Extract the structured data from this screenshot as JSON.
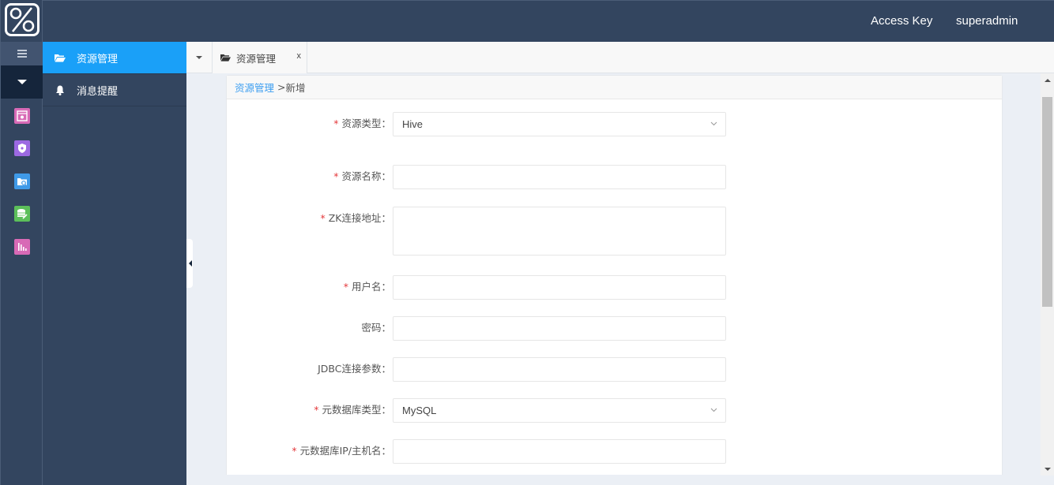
{
  "header": {
    "access_key_label": "Access Key",
    "username": "superadmin"
  },
  "rail": {
    "icons": [
      {
        "name": "dashboard-icon",
        "color": "#d86ab6"
      },
      {
        "name": "shield-icon",
        "color": "#9c69e2"
      },
      {
        "name": "folder-search-icon",
        "color": "#3f9ae8"
      },
      {
        "name": "database-edit-icon",
        "color": "#5cbf5a"
      },
      {
        "name": "bar-chart-icon",
        "color": "#d86ab6"
      }
    ]
  },
  "nav": {
    "items": [
      {
        "label": "资源管理",
        "icon": "folder-open-icon",
        "active": true
      },
      {
        "label": "消息提醒",
        "icon": "bell-icon",
        "active": false
      }
    ]
  },
  "tabs": [
    {
      "label": "资源管理",
      "close": "x"
    }
  ],
  "breadcrumb": {
    "parent": "资源管理",
    "separator": ">",
    "current": "新增"
  },
  "form": {
    "fields": [
      {
        "label": "资源类型：",
        "required": true,
        "type": "select",
        "value": "Hive"
      },
      {
        "label": "资源名称：",
        "required": true,
        "type": "text",
        "value": ""
      },
      {
        "label": "ZK连接地址：",
        "required": true,
        "type": "textarea",
        "value": ""
      },
      {
        "label": "用户名：",
        "required": true,
        "type": "text",
        "value": ""
      },
      {
        "label": "密码：",
        "required": false,
        "type": "password",
        "value": ""
      },
      {
        "label": "JDBC连接参数：",
        "required": false,
        "type": "text",
        "value": ""
      },
      {
        "label": "元数据库类型：",
        "required": true,
        "type": "select",
        "value": "MySQL"
      },
      {
        "label": "元数据库IP/主机名：",
        "required": true,
        "type": "text",
        "value": ""
      }
    ],
    "required_mark": "*"
  },
  "colors": {
    "header_bg": "#33455f",
    "active_nav": "#1aa0f8",
    "link": "#3d9ef0",
    "required": "#e4393c"
  }
}
